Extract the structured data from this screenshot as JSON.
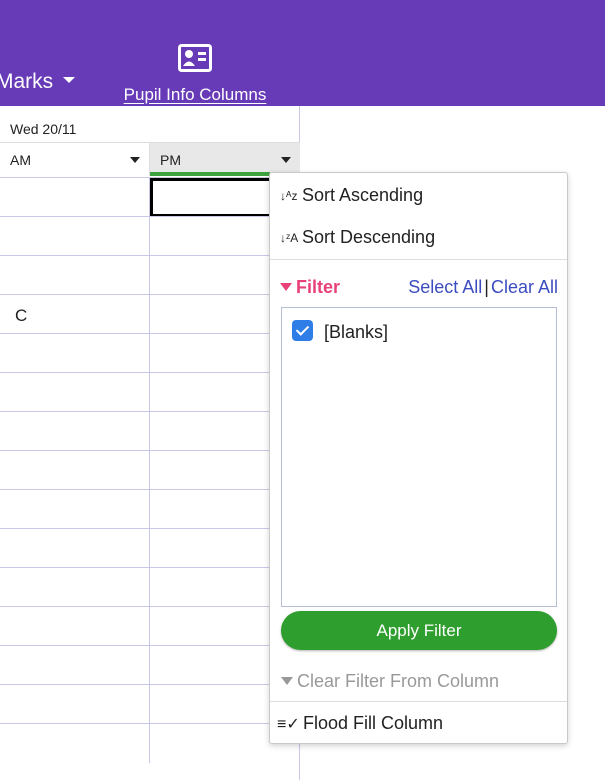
{
  "toolbar": {
    "marks_label": "Marks",
    "pupil_info_label": "Pupil Info Columns",
    "background": "#673ab7"
  },
  "grid": {
    "date": "Wed 20/11",
    "columns": [
      "AM",
      "PM"
    ],
    "rows": [
      {
        "am": "",
        "pm": ""
      },
      {
        "am": "",
        "pm": ""
      },
      {
        "am": "",
        "pm": ""
      },
      {
        "am": "C",
        "pm": ""
      },
      {
        "am": "",
        "pm": ""
      },
      {
        "am": "",
        "pm": ""
      },
      {
        "am": "",
        "pm": ""
      },
      {
        "am": "",
        "pm": ""
      },
      {
        "am": "",
        "pm": ""
      },
      {
        "am": "",
        "pm": ""
      },
      {
        "am": "",
        "pm": ""
      },
      {
        "am": "",
        "pm": ""
      },
      {
        "am": "",
        "pm": ""
      },
      {
        "am": "",
        "pm": ""
      },
      {
        "am": "",
        "pm": ""
      }
    ],
    "accent": "#3da33d"
  },
  "menu": {
    "sort_ascending": "Sort Ascending",
    "sort_descending": "Sort Descending",
    "filter_label": "Filter",
    "select_all": "Select All",
    "separator": "|",
    "clear_all": "Clear All",
    "filter_options": [
      {
        "label": "[Blanks]",
        "checked": true
      }
    ],
    "apply_filter": "Apply Filter",
    "clear_filter_from_column": "Clear Filter From Column",
    "flood_fill_column": "Flood Fill Column",
    "colors": {
      "filter": "#e8417a",
      "link": "#3b4cc0",
      "apply": "#2e9e2e",
      "checkbox": "#2f7ee8"
    }
  }
}
